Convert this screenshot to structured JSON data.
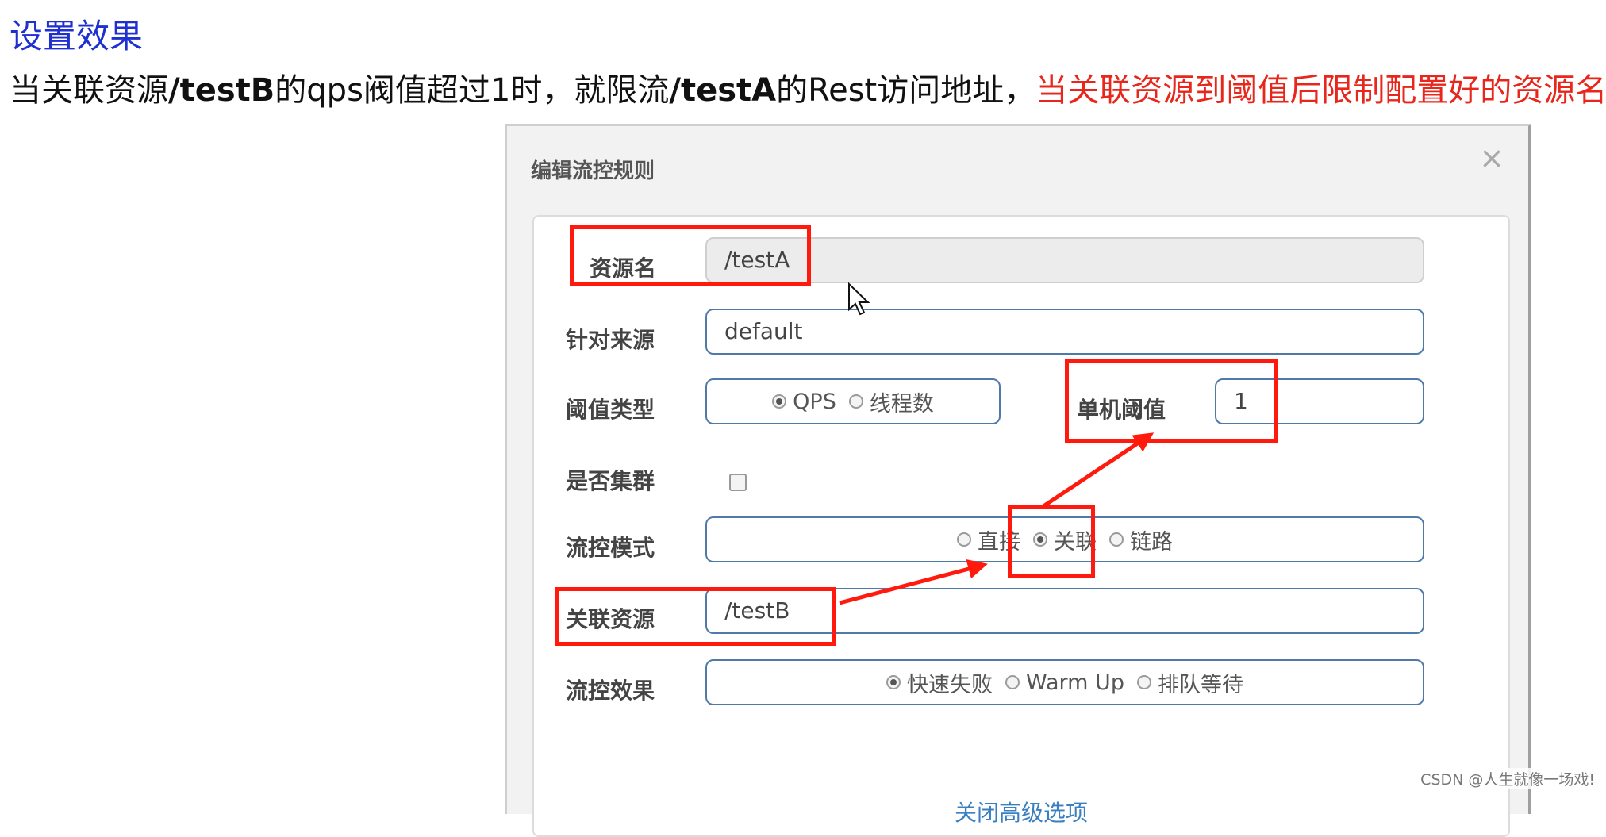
{
  "heading": "设置效果",
  "description": {
    "p1": "当关联资源",
    "p2": "/testB",
    "p3": "的",
    "p4": "qps",
    "p5": "阀值超过",
    "p6": "1",
    "p7": "时，就限流",
    "p8": "/testA",
    "p9": "的",
    "p10": "Rest",
    "p11": "访问地址，",
    "red": "当关联资源到阈值后限制配置好的资源名"
  },
  "modal": {
    "title": "编辑流控规则",
    "close_label": "×",
    "resource_name": {
      "label": "资源名",
      "value": "/testA"
    },
    "limit_app": {
      "label": "针对来源",
      "value": "default"
    },
    "threshold_type": {
      "label": "阈值类型",
      "options": [
        "QPS",
        "线程数"
      ],
      "selected": "QPS"
    },
    "single_threshold": {
      "label": "单机阈值",
      "value": "1"
    },
    "cluster": {
      "label": "是否集群",
      "checked": false
    },
    "flow_mode": {
      "label": "流控模式",
      "options": [
        "直接",
        "关联",
        "链路"
      ],
      "selected": "关联"
    },
    "related_resource": {
      "label": "关联资源",
      "value": "/testB"
    },
    "flow_effect": {
      "label": "流控效果",
      "options": [
        "快速失败",
        "Warm Up",
        "排队等待"
      ],
      "selected": "快速失败"
    },
    "advanced_link": "关闭高级选项"
  },
  "watermark": "CSDN @人生就像一场戏!",
  "colors": {
    "annotation_red": "#ff1a0d",
    "heading_blue": "#1f2fd0",
    "input_border": "#4f7aa8"
  }
}
